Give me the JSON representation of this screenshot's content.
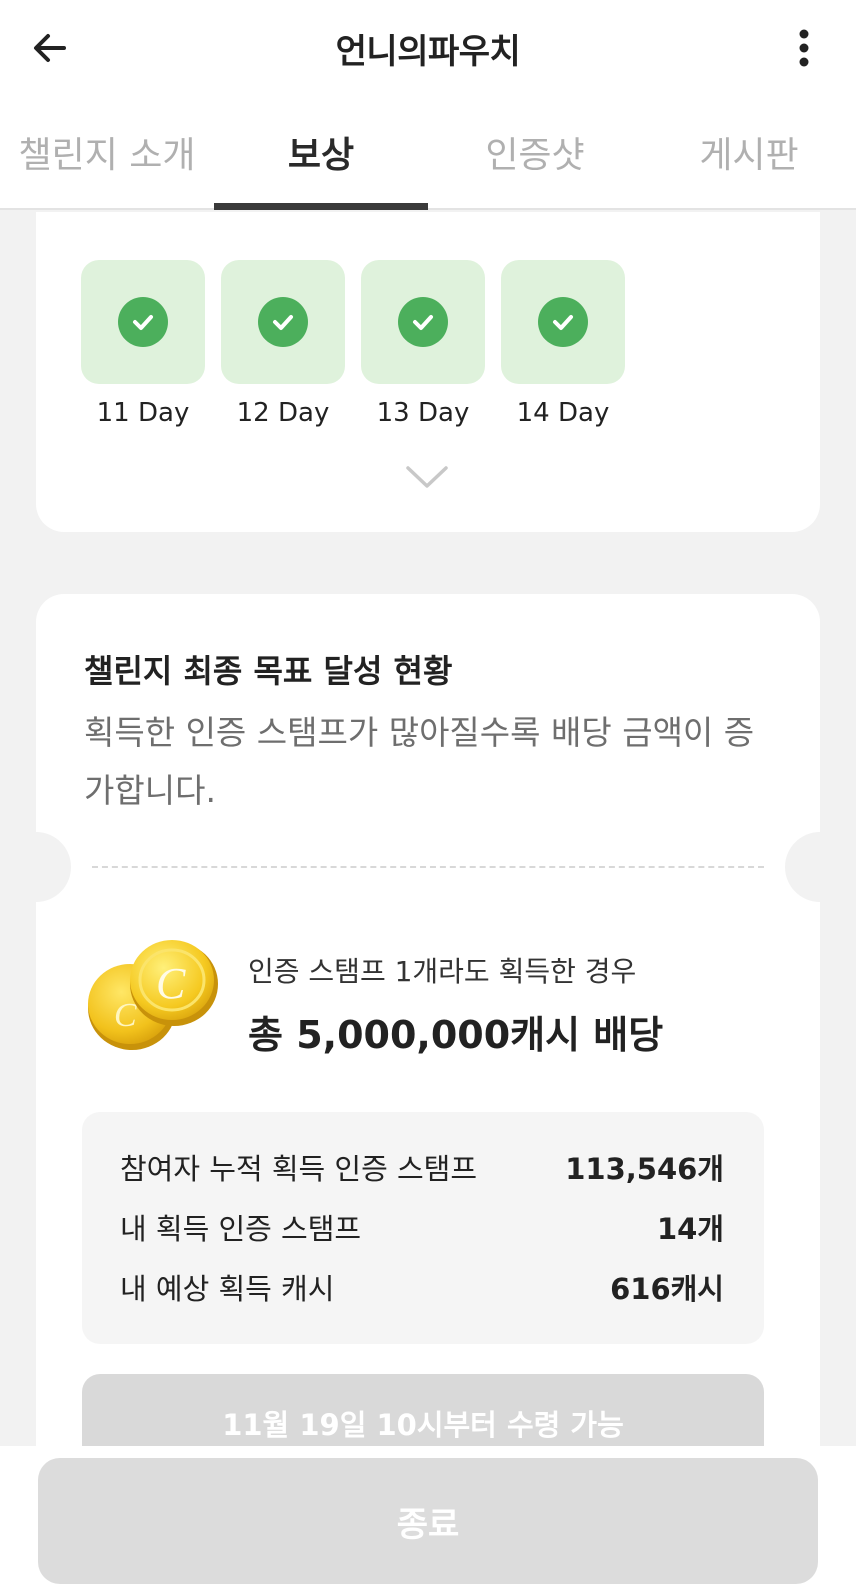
{
  "header": {
    "title": "언니의파우치",
    "back_icon": "arrow-left-icon",
    "more_icon": "more-vertical-icon"
  },
  "tabs": [
    {
      "label": "챌린지 소개",
      "active": false
    },
    {
      "label": "보상",
      "active": true
    },
    {
      "label": "인증샷",
      "active": false
    },
    {
      "label": "게시판",
      "active": false
    }
  ],
  "stamps": {
    "days": [
      {
        "label": "11 Day",
        "checked": true
      },
      {
        "label": "12 Day",
        "checked": true
      },
      {
        "label": "13 Day",
        "checked": true
      },
      {
        "label": "14 Day",
        "checked": true
      }
    ],
    "expand_icon": "chevron-down-icon"
  },
  "goal": {
    "title": "챌린지 최종 목표 달성 현황",
    "description": "획득한 인증 스탬프가 많아질수록 배당 금액이 증가합니다.",
    "reward_condition": "인증 스탬프 1개라도 획득한 경우",
    "reward_amount": "총 5,000,000캐시 배당",
    "coin_icon": "coin-icon"
  },
  "stats": [
    {
      "label": "참여자 누적 획득 인증 스탬프",
      "value": "113,546개"
    },
    {
      "label": "내 획득 인증 스탬프",
      "value": "14개"
    },
    {
      "label": "내 예상 획득 캐시",
      "value": "616캐시"
    }
  ],
  "claim_button": "11월 19일 10시부터 수령 가능",
  "end_button": "종료",
  "colors": {
    "check_green": "#4caf5c",
    "stamp_bg": "#dff2dc",
    "disabled_button": "#d9d9d9"
  }
}
